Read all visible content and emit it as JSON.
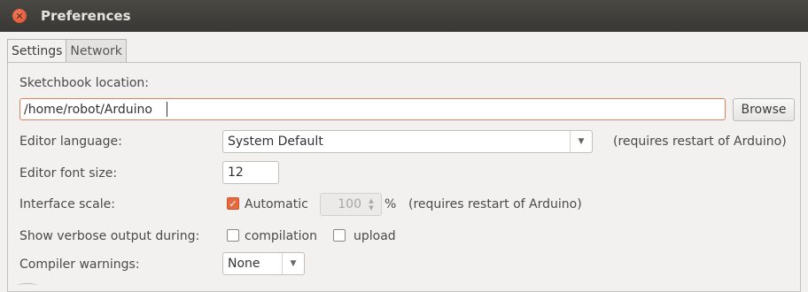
{
  "window": {
    "title": "Preferences"
  },
  "tabs": [
    {
      "label": "Settings",
      "active": true
    },
    {
      "label": "Network",
      "active": false
    }
  ],
  "sketchbook": {
    "label": "Sketchbook location:",
    "value": "/home/robot/Arduino",
    "browse_label": "Browse"
  },
  "editor_language": {
    "label": "Editor language:",
    "selected": "System Default",
    "note": "(requires restart of Arduino)"
  },
  "font_size": {
    "label": "Editor font size:",
    "value": "12"
  },
  "interface_scale": {
    "label": "Interface scale:",
    "automatic_label": "Automatic",
    "automatic_checked": true,
    "scale_value": "100",
    "percent": "%",
    "note": "(requires restart of Arduino)"
  },
  "verbose": {
    "label": "Show verbose output during:",
    "compilation_label": "compilation",
    "compilation_checked": false,
    "upload_label": "upload",
    "upload_checked": false
  },
  "warnings": {
    "label": "Compiler warnings:",
    "selected": "None"
  },
  "colors": {
    "accent": "#e4693f",
    "titlebar": "#3e3c38",
    "close": "#df5430"
  },
  "icons": {
    "close": "close-icon",
    "dropdown": "chevron-down-icon",
    "spin": "spin-arrows-icon",
    "check": "checkmark-icon"
  }
}
